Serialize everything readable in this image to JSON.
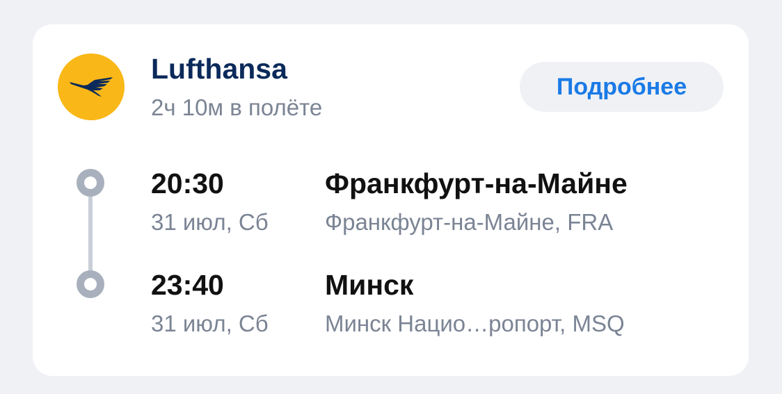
{
  "flight": {
    "airline": "Lufthansa",
    "airline_logo_icon": "lufthansa-crane-icon",
    "logo_color": "#f9b817",
    "duration": "2ч 10м в полёте",
    "details_label": "Подробнее",
    "accent_color": "#1a7ae6"
  },
  "segments": [
    {
      "time": "20:30",
      "date": "31 июл, Сб",
      "city": "Франкфурт-на-Майне",
      "airport": "Франкфурт-на-Майне, FRA"
    },
    {
      "time": "23:40",
      "date": "31 июл, Сб",
      "city": "Минск",
      "airport": "Минск Нацио…ропорт, MSQ"
    }
  ]
}
